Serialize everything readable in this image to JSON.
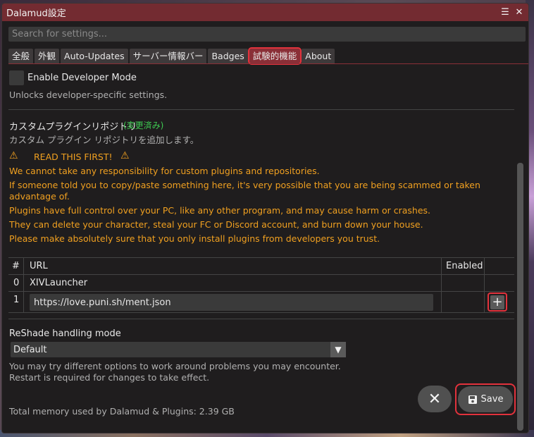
{
  "window": {
    "title": "Dalamud設定"
  },
  "search": {
    "placeholder": "Search for settings..."
  },
  "tabs": [
    {
      "label": "全般"
    },
    {
      "label": "外観"
    },
    {
      "label": "Auto-Updates"
    },
    {
      "label": "サーバー情報バー"
    },
    {
      "label": "Badges"
    },
    {
      "label": "試験的機能"
    },
    {
      "label": "About"
    }
  ],
  "dev_mode": {
    "label": "Enable Developer Mode",
    "description": "Unlocks developer-specific settings."
  },
  "custom_repo": {
    "title": "カスタムプラグインリポジトリ",
    "changed": "(変更済み)",
    "description": "カスタム プラグイン リポジトリを追加します。",
    "warning_heading": "READ THIS FIRST!",
    "warning_lines": [
      "We cannot take any responsibility for custom plugins and repositories.",
      "If someone told you to copy/paste something here, it's very possible that you are being scammed or taken",
      "advantage of.",
      "Plugins have full control over your PC, like any other program, and may cause harm or crashes.",
      "They can delete your character, steal your FC or Discord account, and burn down your house.",
      "Please make absolutely sure that you only install plugins from developers you trust."
    ]
  },
  "table": {
    "headers": {
      "index": "#",
      "url": "URL",
      "enabled": "Enabled"
    },
    "rows": [
      {
        "index": "0",
        "url": "XIVLauncher"
      },
      {
        "index": "1",
        "url": "https://love.puni.sh/ment.json"
      }
    ]
  },
  "reshade": {
    "title": "ReShade handling mode",
    "selected": "Default",
    "help_line1": "You may try different options to work around problems you may encounter.",
    "help_line2": "Restart is required for changes to take effect."
  },
  "footer": {
    "memory": "Total memory used by Dalamud & Plugins: 2.39 GB",
    "save_label": "Save"
  },
  "colors": {
    "accent": "#732b31",
    "highlight": "#e2323c",
    "warning": "#f0a020",
    "changed": "#3ecb52"
  }
}
